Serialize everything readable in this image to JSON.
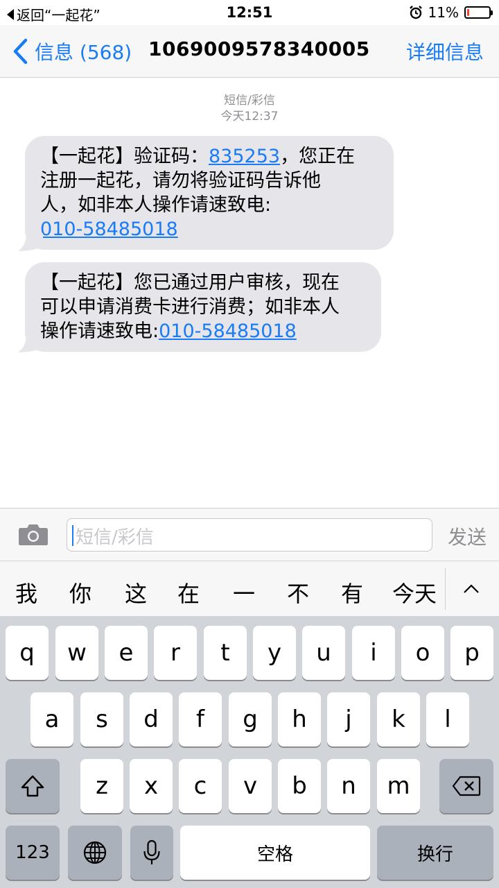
{
  "status_bar": {
    "back_label": "返回“一起花”",
    "time": "12:51",
    "battery_percent": "11%",
    "battery_level": 0.11,
    "icons": [
      "back-triangle-icon",
      "alarm-icon",
      "battery-icon"
    ]
  },
  "nav": {
    "back_label": "信息 (568)",
    "title": "1069009578340005",
    "detail_label": "详细信息"
  },
  "thread": {
    "type_label": "短信/彩信",
    "timestamp": "今天12:37"
  },
  "messages": [
    {
      "line1_prefix": "【一起花】验证码：",
      "code": "835253",
      "line1_suffix": "，您正在",
      "line2": "注册一起花，请勿将验证码告诉他",
      "line3": "人，如非本人操作请速致电:",
      "phone": "010-58485018"
    },
    {
      "line1": "【一起花】您已通过用户审核，现在",
      "line2": "可以申请消费卡进行消费；如非本人",
      "line3_prefix": "操作请速致电:",
      "phone": "010-58485018"
    }
  ],
  "input": {
    "placeholder": "短信/彩信",
    "send_label": "发送",
    "camera_icon": "camera-icon"
  },
  "suggestions": [
    "我",
    "你",
    "这",
    "在",
    "一",
    "不",
    "有",
    "今天"
  ],
  "keyboard": {
    "row1": [
      "q",
      "w",
      "e",
      "r",
      "t",
      "y",
      "u",
      "i",
      "o",
      "p"
    ],
    "row2": [
      "a",
      "s",
      "d",
      "f",
      "g",
      "h",
      "j",
      "k",
      "l"
    ],
    "row3": [
      "z",
      "x",
      "c",
      "v",
      "b",
      "n",
      "m"
    ],
    "num_label": "123",
    "space_label": "空格",
    "return_label": "换行"
  }
}
